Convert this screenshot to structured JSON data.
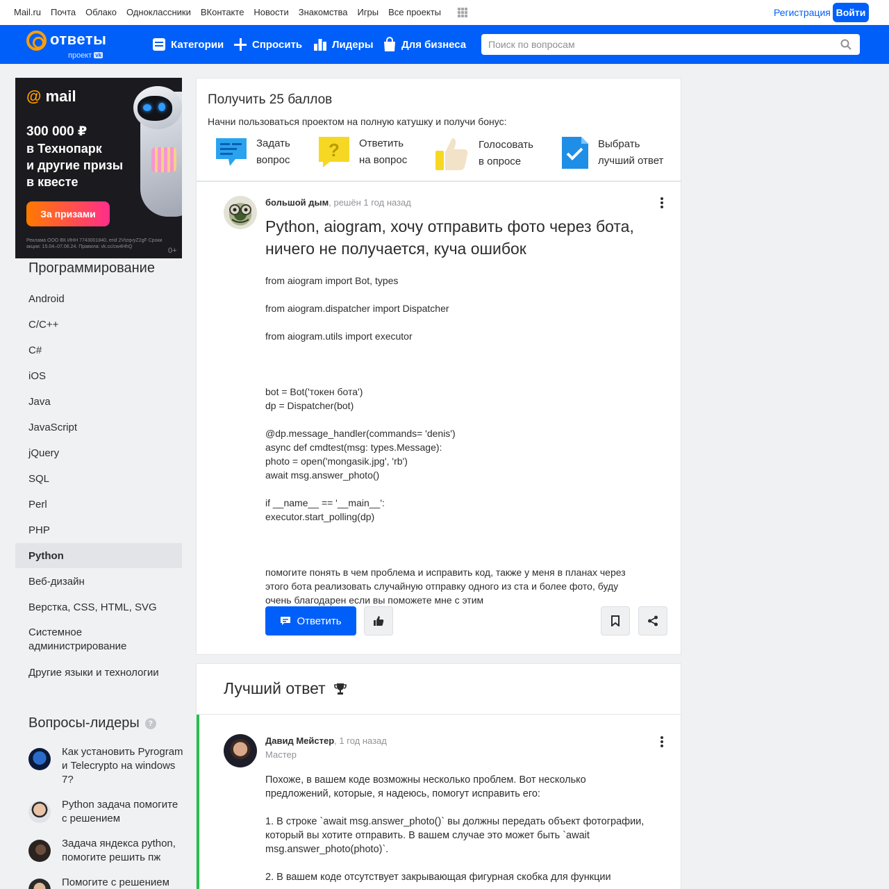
{
  "portal": {
    "links": [
      "Mail.ru",
      "Почта",
      "Облако",
      "Одноклассники",
      "ВКонтакте",
      "Новости",
      "Знакомства",
      "Игры",
      "Все проекты"
    ],
    "register": "Регистрация",
    "login": "Войти"
  },
  "header": {
    "logo": "ответы",
    "logo_sub": "проект",
    "logo_badge": "vk",
    "nav": [
      "Категории",
      "Спросить",
      "Лидеры",
      "Для бизнеса"
    ],
    "search_placeholder": "Поиск по вопросам"
  },
  "ad": {
    "logo": "mail",
    "amount": "300 000 ₽",
    "line1": "в Технопарк",
    "line2": "и другие призы",
    "line3": "в квесте",
    "button": "За призами",
    "legal": "Реклама ООО ВК ИНН 7743001840, erid 2VtzqvyZ2gF Сроки акции: 15.04–07.06.24. Правила: vk.cc/cw4HhQ",
    "age": "0+"
  },
  "sidebar": {
    "title": "Программирование",
    "items": [
      {
        "label": "Android"
      },
      {
        "label": "C/C++"
      },
      {
        "label": "C#"
      },
      {
        "label": "iOS"
      },
      {
        "label": "Java"
      },
      {
        "label": "JavaScript"
      },
      {
        "label": "jQuery"
      },
      {
        "label": "SQL"
      },
      {
        "label": "Perl"
      },
      {
        "label": "PHP"
      },
      {
        "label": "Python"
      },
      {
        "label": "Веб-дизайн"
      },
      {
        "label": "Верстка, CSS, HTML, SVG"
      },
      {
        "label": "Системное администрирование"
      },
      {
        "label": "Другие языки и технологии"
      }
    ],
    "active_index": 10,
    "leaders_title": "Вопросы-лидеры",
    "leaders": [
      {
        "text": "Как установить Pyrogram и Telecrypto на windows 7?"
      },
      {
        "text": "Python задача помогите с решением"
      },
      {
        "text": "Задача яндекса python, помогите решить пж"
      },
      {
        "text": "Помогите с решением"
      }
    ]
  },
  "bonus": {
    "title": "Получить 25 баллов",
    "subtitle": "Начни пользоваться проектом на полную катушку и получи бонус:",
    "items": [
      {
        "line1": "Задать",
        "line2": "вопрос"
      },
      {
        "line1": "Ответить",
        "line2": "на вопрос"
      },
      {
        "line1": "Голосовать",
        "line2": "в опросе"
      },
      {
        "line1": "Выбрать",
        "line2": "лучший ответ"
      }
    ]
  },
  "question": {
    "author": "большой дым",
    "meta": ", решён 1 год назад",
    "title": "Python, aiogram, хочу отправить фото через бота, ничего не получается, куча ошибок",
    "body": [
      "from aiogram import Bot, types",
      "",
      "from aiogram.dispatcher import Dispatcher",
      "",
      "from aiogram.utils import executor",
      "",
      "",
      "",
      "bot = Bot('токен бота')",
      "dp = Dispatcher(bot)",
      "",
      "@dp.message_handler(commands= 'denis')",
      "async def cmdtest(msg: types.Message):",
      "photo = open('mongasik.jpg', 'rb')",
      "await msg.answer_photo()",
      "",
      "if __name__ == '__main__':",
      "executor.start_polling(dp)",
      "",
      "",
      "",
      "помогите понять в чем проблема и исправить код, также у меня в планах через",
      "этого бота реализовать случайную отправку одного из ста и более фото, буду",
      "очень благодарен если вы поможете мне с этим"
    ],
    "answer_button": "Ответить"
  },
  "best": {
    "title": "Лучший ответ",
    "author": "Давид Мейстер",
    "meta": ", 1 год назад",
    "rank": "Мастер",
    "body": [
      "Похоже, в вашем коде возможны несколько проблем. Вот несколько",
      "предложений, которые, я надеюсь, помогут исправить его:",
      "",
      "1. В строке `await msg.answer_photo()` вы должны передать объект фотографии,",
      "который вы хотите отправить. В вашем случае это может быть `await",
      "msg.answer_photo(photo)`.",
      "",
      "2. В вашем коде отсутствует закрывающая фигурная скобка для функции"
    ]
  },
  "colors": {
    "brand": "#005ff9",
    "accent": "#ff9e00",
    "success": "#25c04b"
  }
}
